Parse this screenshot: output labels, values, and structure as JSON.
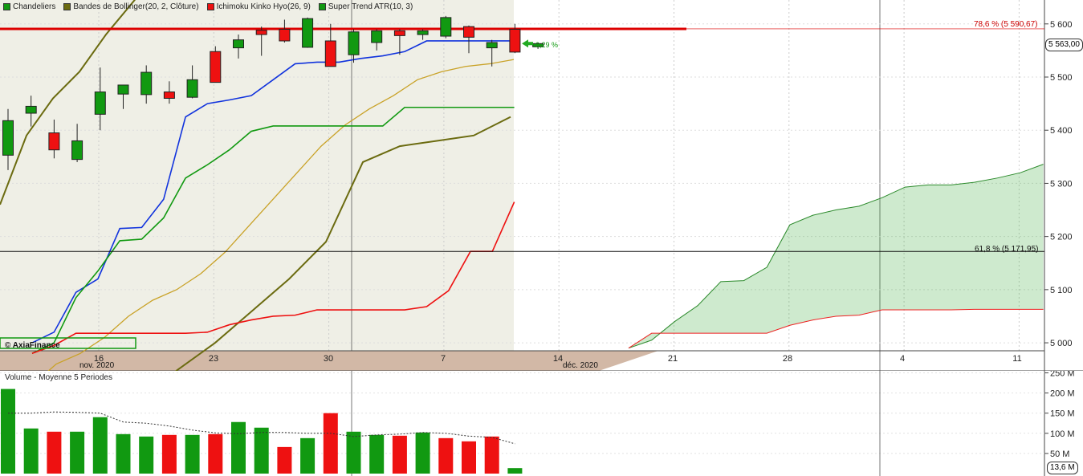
{
  "legend": [
    {
      "label": "Chandeliers",
      "color": "#119911"
    },
    {
      "label": "Bandes de Bollinger(20, 2, Clôture)",
      "color": "#6b6b10"
    },
    {
      "label": "Ichimoku Kinko Hyo(26, 9)",
      "color": "#ee1111"
    },
    {
      "label": "Super Trend ATR(10, 3)",
      "color": "#119911"
    }
  ],
  "watermark": "© AxiaFinance",
  "fib": [
    {
      "label": "78,6 % (5 590,67)",
      "value": 5590.67,
      "color": "#cc0000"
    },
    {
      "label": "61,8 % (5 171,95)",
      "value": 5171.95,
      "color": "#111111"
    }
  ],
  "last_price": "5 563,00",
  "change": "0,29 %",
  "volume_legend": "Volume  - Moyenne 5 Periodes",
  "volume_last": "13,6 M",
  "x_labels": [
    "16",
    "23",
    "30",
    "7",
    "14",
    "21",
    "28",
    "4",
    "11"
  ],
  "months": [
    "nov. 2020",
    "déc. 2020"
  ],
  "chart_data": {
    "type": "candlestick",
    "price_axis": {
      "ticks": [
        5000,
        5100,
        5200,
        5300,
        5400,
        5500,
        5600
      ],
      "tick_labels": [
        "5 000",
        "5 100",
        "5 200",
        "5 300",
        "5 400",
        "5 500",
        "5 600"
      ],
      "ylim": [
        4985,
        5645
      ]
    },
    "candles": [
      {
        "o": 5353,
        "h": 5440,
        "l": 5325,
        "c": 5418
      },
      {
        "o": 5432,
        "h": 5465,
        "l": 5407,
        "c": 5445
      },
      {
        "o": 5395,
        "h": 5420,
        "l": 5347,
        "c": 5363
      },
      {
        "o": 5345,
        "h": 5412,
        "l": 5340,
        "c": 5380
      },
      {
        "o": 5430,
        "h": 5518,
        "l": 5400,
        "c": 5472
      },
      {
        "o": 5468,
        "h": 5485,
        "l": 5440,
        "c": 5485
      },
      {
        "o": 5467,
        "h": 5522,
        "l": 5450,
        "c": 5509
      },
      {
        "o": 5472,
        "h": 5492,
        "l": 5450,
        "c": 5460
      },
      {
        "o": 5462,
        "h": 5522,
        "l": 5460,
        "c": 5495
      },
      {
        "o": 5548,
        "h": 5558,
        "l": 5490,
        "c": 5490
      },
      {
        "o": 5555,
        "h": 5580,
        "l": 5535,
        "c": 5570
      },
      {
        "o": 5588,
        "h": 5595,
        "l": 5540,
        "c": 5580
      },
      {
        "o": 5590,
        "h": 5608,
        "l": 5565,
        "c": 5568
      },
      {
        "o": 5556,
        "h": 5612,
        "l": 5555,
        "c": 5610
      },
      {
        "o": 5568,
        "h": 5600,
        "l": 5520,
        "c": 5520
      },
      {
        "o": 5542,
        "h": 5590,
        "l": 5527,
        "c": 5585
      },
      {
        "o": 5565,
        "h": 5590,
        "l": 5550,
        "c": 5587
      },
      {
        "o": 5587,
        "h": 5590,
        "l": 5542,
        "c": 5578
      },
      {
        "o": 5580,
        "h": 5590,
        "l": 5570,
        "c": 5587
      },
      {
        "o": 5577,
        "h": 5615,
        "l": 5573,
        "c": 5612
      },
      {
        "o": 5595,
        "h": 5597,
        "l": 5545,
        "c": 5575
      },
      {
        "o": 5555,
        "h": 5570,
        "l": 5520,
        "c": 5565
      },
      {
        "o": 5590,
        "h": 5600,
        "l": 5545,
        "c": 5547
      },
      {
        "o": 5557,
        "h": 5565,
        "l": 5553,
        "c": 5563
      }
    ],
    "bollinger_upper": [
      5260,
      5390,
      5460,
      5510,
      5580,
      5640,
      5700,
      5760,
      5810,
      5860,
      5900
    ],
    "bollinger_middle": [
      4920,
      4960,
      4980,
      5010,
      5050,
      5080,
      5100,
      5130,
      5170,
      5220,
      5270,
      5320,
      5370,
      5410,
      5440,
      5465,
      5495,
      5510,
      5520,
      5525,
      5533
    ],
    "bollinger_lower": [
      4850,
      4900,
      4950,
      5000,
      5060,
      5120,
      5190,
      5340,
      5370,
      5380,
      5390,
      5425
    ],
    "tenkan": [
      5000,
      5020,
      5095,
      5120,
      5215,
      5217,
      5270,
      5425,
      5450,
      5457,
      5465,
      5495,
      5525,
      5528,
      5528,
      5535,
      5540,
      5548,
      5568,
      5568,
      5568,
      5568,
      5568
    ],
    "kijun": [
      4980,
      5000,
      5085,
      5135,
      5192,
      5195,
      5235,
      5310,
      5335,
      5363,
      5398,
      5408,
      5408,
      5408,
      5408,
      5408,
      5408,
      5443,
      5443,
      5443,
      5443,
      5443,
      5443
    ],
    "super_trend": [
      4980,
      4995,
      5018,
      5018,
      5018,
      5018,
      5018,
      5018,
      5020,
      5034,
      5043,
      5050,
      5052,
      5062,
      5062,
      5062,
      5062,
      5062,
      5068,
      5098,
      5172,
      5172,
      5265
    ],
    "senkou_a": [
      4990,
      5005,
      5040,
      5070,
      5115,
      5117,
      5142,
      5222,
      5240,
      5250,
      5257,
      5273,
      5293,
      5297,
      5297,
      5302,
      5310,
      5320,
      5336
    ],
    "senkou_b": [
      4990,
      5018,
      5018,
      5018,
      5018,
      5018,
      5018,
      5033,
      5043,
      5050,
      5052,
      5062,
      5062,
      5062,
      5062,
      5063,
      5063,
      5063,
      5063
    ],
    "volume_axis": {
      "ticks": [
        50,
        100,
        150,
        200,
        250
      ],
      "tick_labels": [
        "50 M",
        "100 M",
        "150 M",
        "200 M",
        "250 M"
      ],
      "ylim": [
        0,
        255
      ]
    },
    "volume": [
      210,
      112,
      104,
      104,
      140,
      98,
      92,
      96,
      96,
      98,
      128,
      114,
      66,
      88,
      150,
      104,
      96,
      94,
      102,
      88,
      80,
      92,
      13.6
    ],
    "volume_up": [
      true,
      true,
      false,
      true,
      true,
      true,
      true,
      false,
      true,
      false,
      true,
      true,
      false,
      true,
      false,
      true,
      true,
      false,
      true,
      false,
      false,
      false,
      true
    ],
    "volume_ma": [
      150,
      150,
      153,
      152,
      150,
      128,
      125,
      118,
      108,
      101,
      99,
      102,
      102,
      100,
      100,
      92,
      96,
      98,
      102,
      100,
      93,
      90,
      74
    ]
  }
}
